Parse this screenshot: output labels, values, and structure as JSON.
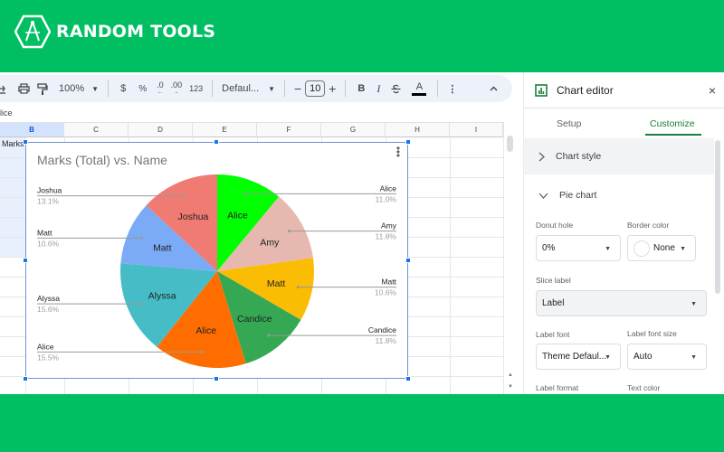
{
  "brand": {
    "name": "RANDOM TOOLS",
    "color": "#00bf63"
  },
  "toolbar": {
    "zoom": "100%",
    "currency": "$",
    "percent": "%",
    "decrease_decimal": ".0",
    "increase_decimal": ".00",
    "number_format": "123",
    "font": "Defaul...",
    "font_size": "10",
    "minus": "−",
    "plus": "+",
    "bold": "B",
    "italic": "I",
    "text_color": "A",
    "more": "⋮",
    "collapse": "^"
  },
  "formula_bar": {
    "value": "lice"
  },
  "grid": {
    "columns": [
      "B",
      "C",
      "D",
      "E",
      "F",
      "G",
      "H",
      "I"
    ],
    "selected_column": "B",
    "cell_b1": "Marks"
  },
  "chart_data": {
    "type": "pie",
    "title": "Marks (Total) vs. Name",
    "slices": [
      {
        "label": "Alice",
        "percent": 11.0,
        "color": "#00ff00"
      },
      {
        "label": "Amy",
        "percent": 11.8,
        "color": "#e6b8af"
      },
      {
        "label": "Matt",
        "percent": 10.6,
        "color": "#fbbc04"
      },
      {
        "label": "Candice",
        "percent": 11.8,
        "color": "#34a853"
      },
      {
        "label": "Alice",
        "percent": 15.5,
        "color": "#ff6d01"
      },
      {
        "label": "Alyssa",
        "percent": 15.6,
        "color": "#46bdc6"
      },
      {
        "label": "Matt",
        "percent": 10.6,
        "color": "#7baaf7"
      },
      {
        "label": "Joshua",
        "percent": 13.1,
        "color": "#f07b72"
      }
    ],
    "slice_label": "Label",
    "legend": "labeled",
    "donut_hole": "0%"
  },
  "chart_editor": {
    "title": "Chart editor",
    "close": "×",
    "tabs": [
      {
        "label": "Setup",
        "active": false
      },
      {
        "label": "Customize",
        "active": true
      }
    ],
    "chart_style": {
      "label": "Chart style"
    },
    "pie_chart": {
      "label": "Pie chart",
      "donut_hole_label": "Donut hole",
      "donut_hole_value": "0%",
      "border_color_label": "Border color",
      "border_color_value": "None",
      "slice_label_label": "Slice label",
      "slice_label_value": "Label",
      "label_font_label": "Label font",
      "label_font_value": "Theme Defaul...",
      "label_font_size_label": "Label font size",
      "label_font_size_value": "Auto",
      "label_format_label": "Label format",
      "text_color_label": "Text color"
    },
    "accent": "#188038"
  }
}
